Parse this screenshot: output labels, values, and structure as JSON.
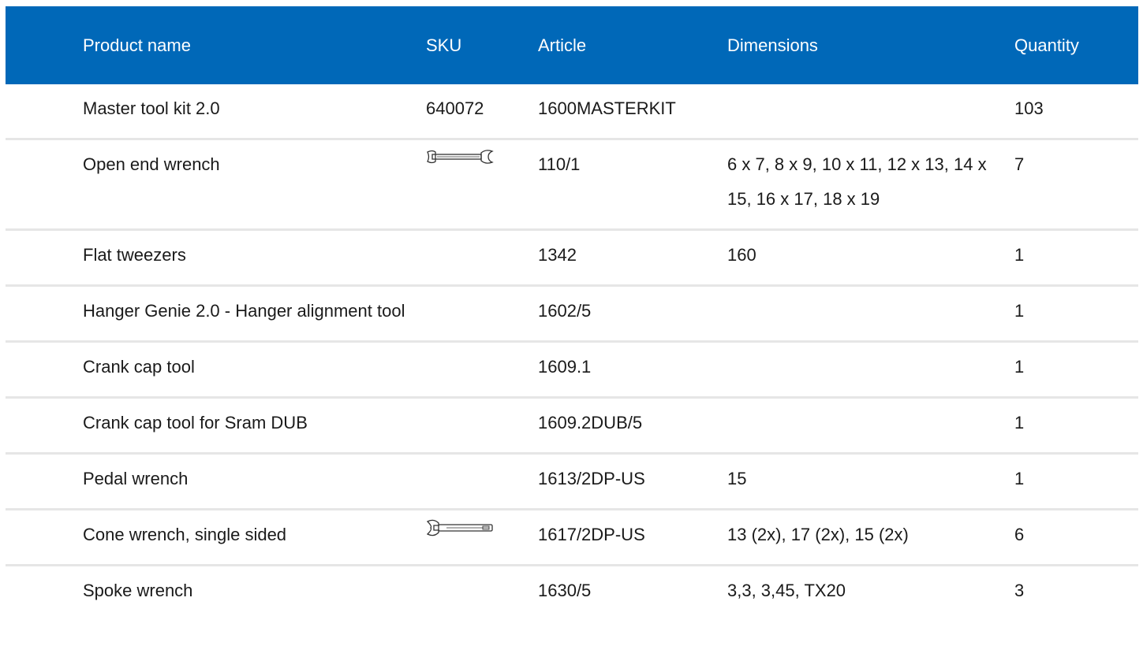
{
  "table": {
    "columns": [
      "Product name",
      "SKU",
      "Article",
      "Dimensions",
      "Quantity"
    ],
    "rows": [
      {
        "name": "Master tool kit 2.0",
        "sku": "640072",
        "sku_icon": "",
        "article": "1600MASTERKIT",
        "dimensions": "",
        "quantity": "103"
      },
      {
        "name": "Open end wrench",
        "sku": "",
        "sku_icon": "open-end-wrench-icon",
        "article": "110/1",
        "dimensions": "6 x 7, 8 x 9, 10 x 11, 12 x 13, 14 x 15, 16 x 17, 18 x 19",
        "quantity": "7"
      },
      {
        "name": "Flat tweezers",
        "sku": "",
        "sku_icon": "",
        "article": "1342",
        "dimensions": "160",
        "quantity": "1"
      },
      {
        "name": "Hanger Genie 2.0 - Hanger alignment tool",
        "sku": "",
        "sku_icon": "",
        "article": "1602/5",
        "dimensions": "",
        "quantity": "1"
      },
      {
        "name": "Crank cap tool",
        "sku": "",
        "sku_icon": "",
        "article": "1609.1",
        "dimensions": "",
        "quantity": "1"
      },
      {
        "name": "Crank cap tool for Sram DUB",
        "sku": "",
        "sku_icon": "",
        "article": "1609.2DUB/5",
        "dimensions": "",
        "quantity": "1"
      },
      {
        "name": "Pedal wrench",
        "sku": "",
        "sku_icon": "",
        "article": "1613/2DP-US",
        "dimensions": "15",
        "quantity": "1"
      },
      {
        "name": "Cone wrench, single sided",
        "sku": "",
        "sku_icon": "cone-wrench-icon",
        "article": "1617/2DP-US",
        "dimensions": "13 (2x), 17 (2x), 15 (2x)",
        "quantity": "6"
      },
      {
        "name": "Spoke wrench",
        "sku": "",
        "sku_icon": "",
        "article": "1630/5",
        "dimensions": "3,3, 3,45, TX20",
        "quantity": "3"
      }
    ]
  },
  "colors": {
    "header_bg": "#0068b8",
    "header_text": "#ffffff",
    "row_divider": "#e6e6e6"
  }
}
